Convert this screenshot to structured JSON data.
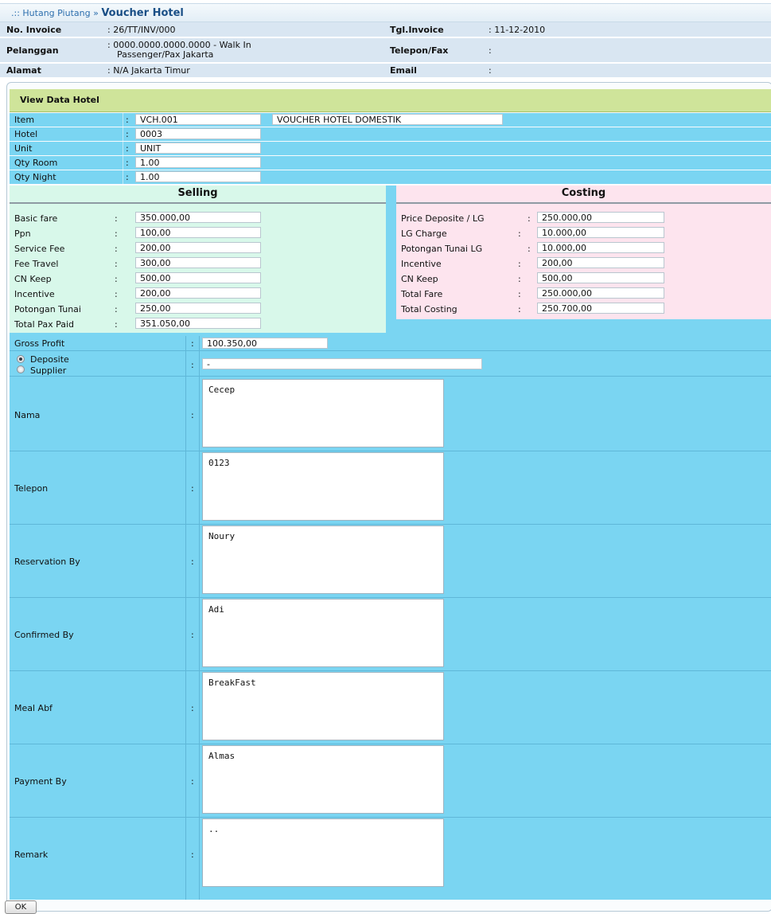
{
  "header": {
    "breadcrumb_prefix": ".:: Hutang Piutang »",
    "title": "Voucher Hotel",
    "no_invoice_label": "No. Invoice",
    "no_invoice_value": ": 26/TT/INV/000",
    "tgl_invoice_label": "Tgl.Invoice",
    "tgl_invoice_value": ": 11-12-2010",
    "pelanggan_label": "Pelanggan",
    "pelanggan_value_1": ": 0000.0000.0000.0000 - Walk In",
    "pelanggan_value_2": "Passenger/Pax Jakarta",
    "telepon_fax_label": "Telepon/Fax",
    "telepon_fax_value": ":",
    "alamat_label": "Alamat",
    "alamat_value": ": N/A Jakarta Timur",
    "email_label": "Email",
    "email_value": ":"
  },
  "section_title": "View Data Hotel",
  "top_fields": [
    {
      "label": "Item",
      "value": "VCH.001",
      "extra": "VOUCHER HOTEL DOMESTIK"
    },
    {
      "label": "Hotel",
      "value": "0003"
    },
    {
      "label": "Unit",
      "value": "UNIT"
    },
    {
      "label": "Qty Room",
      "value": "1.00"
    },
    {
      "label": "Qty Night",
      "value": "1.00"
    }
  ],
  "selling": {
    "title": "Selling",
    "rows": [
      {
        "label": "Basic fare",
        "value": "350.000,00"
      },
      {
        "label": "Ppn",
        "value": "100,00"
      },
      {
        "label": "Service Fee",
        "value": "200,00"
      },
      {
        "label": "Fee Travel",
        "value": "300,00"
      },
      {
        "label": "CN Keep",
        "value": "500,00"
      },
      {
        "label": "Incentive",
        "value": "200,00"
      },
      {
        "label": "Potongan Tunai",
        "value": "250,00"
      },
      {
        "label": "Total Pax Paid",
        "value": "351.050,00"
      }
    ]
  },
  "costing": {
    "title": "Costing",
    "rows": [
      {
        "label": "Price Deposite / LG",
        "value": "250.000,00"
      },
      {
        "label": "LG Charge",
        "value": "10.000,00"
      },
      {
        "label": "Potongan Tunai LG",
        "value": "10.000,00"
      },
      {
        "label": "Incentive",
        "value": "200,00"
      },
      {
        "label": "CN Keep",
        "value": "500,00"
      },
      {
        "label": "Total Fare",
        "value": "250.000,00"
      },
      {
        "label": "Total Costing",
        "value": "250.700,00"
      }
    ]
  },
  "gross_profit": {
    "label": "Gross Profit",
    "value": "100.350,00"
  },
  "payment_source": {
    "option_deposite": "Deposite",
    "option_supplier": "Supplier",
    "selected": "Deposite",
    "value": "-"
  },
  "details": [
    {
      "label": "Nama",
      "value": "Cecep"
    },
    {
      "label": "Telepon",
      "value": "0123"
    },
    {
      "label": "Reservation By",
      "value": "Noury"
    },
    {
      "label": "Confirmed By",
      "value": "Adi"
    },
    {
      "label": "Meal Abf",
      "value": "BreakFast"
    },
    {
      "label": "Payment By",
      "value": "Almas"
    },
    {
      "label": "Remark",
      "value": ".."
    }
  ],
  "colon": ":",
  "ok_button": "OK"
}
